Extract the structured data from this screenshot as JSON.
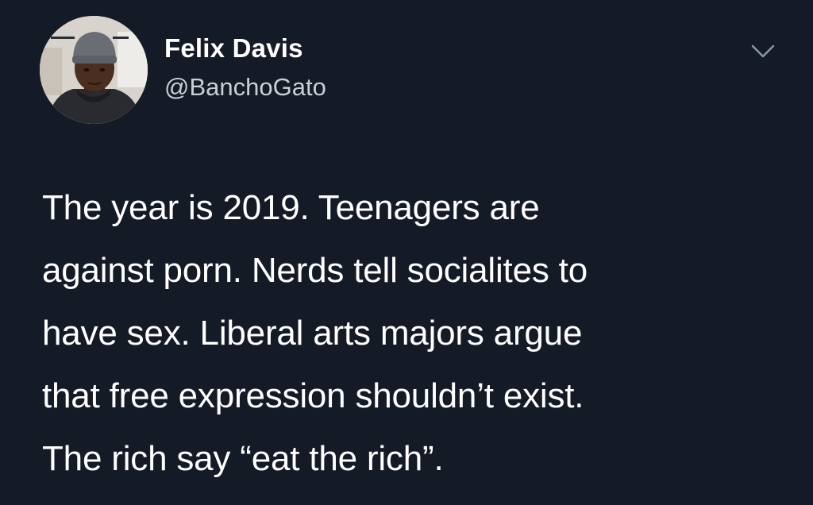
{
  "user": {
    "display_name": "Felix Davis",
    "handle": "@BanchoGato"
  },
  "tweet": {
    "lines": [
      "The year is 2019. Teenagers are",
      "against porn. Nerds tell socialites to",
      "have sex. Liberal arts majors argue",
      "that free expression shouldn’t exist.",
      "The rich say “eat the rich”."
    ]
  },
  "icons": {
    "menu": "chevron-down-icon",
    "avatar": "user-avatar"
  },
  "colors": {
    "background": "#151a27",
    "text": "#ffffff",
    "secondary_text": "#c9cfd8",
    "chevron": "#8b96a6"
  }
}
